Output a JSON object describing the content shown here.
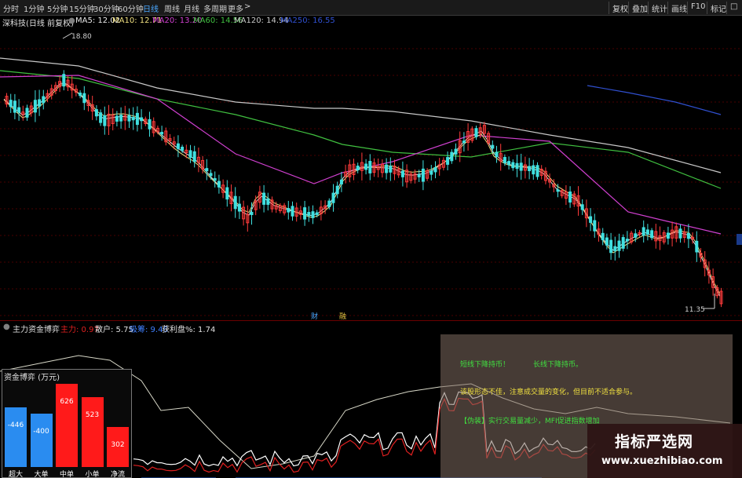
{
  "toolbar": {
    "periods": [
      "分时",
      "1分钟",
      "5分钟",
      "15分钟",
      "30分钟",
      "60分钟",
      "日线",
      "周线",
      "月线",
      "多周期",
      "更多"
    ],
    "active_period": "日线",
    "more_arrow": ">",
    "right_buttons": [
      "复权",
      "叠加",
      "统计",
      "画线",
      "F10",
      "标记"
    ],
    "expand_icon": "□"
  },
  "main_chart": {
    "stock_label": "深科技(日线 前复权)",
    "settings_icon": "●",
    "ma": [
      {
        "label": "MA5: 12.02",
        "color": "#e8e8e8"
      },
      {
        "label": "MA10: 12.71",
        "color": "#f0e080"
      },
      {
        "label": "MA20: 13.20",
        "color": "#d040d0"
      },
      {
        "label": "MA60: 14.56",
        "color": "#40c040"
      },
      {
        "label": "MA120: 14.94",
        "color": "#c8c8c8"
      },
      {
        "label": "MA250: 16.55",
        "color": "#3050d0"
      }
    ],
    "high_marker": "18.80",
    "low_marker": "11.35",
    "event_labels": [
      "财",
      "融"
    ]
  },
  "indicator": {
    "name": "主力资金博弈",
    "fields": [
      {
        "label": "主力: 0.97",
        "color": "#e02020"
      },
      {
        "label": "散户: 5.75",
        "color": "#e0e0e0"
      },
      {
        "label": "吸筹: 9.46",
        "color": "#4080ff"
      },
      {
        "label": "获利盘%: 1.74",
        "color": "#e0e0e0"
      }
    ]
  },
  "capital_panel": {
    "title": "资金博弈 (万元)",
    "bars": [
      {
        "label": "超大",
        "value": "-446",
        "amount": -446,
        "color": "#2a8cf0"
      },
      {
        "label": "大单",
        "value": "-400",
        "amount": -400,
        "color": "#2a8cf0"
      },
      {
        "label": "中单",
        "value": "626",
        "amount": 626,
        "color": "#ff1a1a"
      },
      {
        "label": "小单",
        "value": "523",
        "amount": 523,
        "color": "#ff1a1a"
      },
      {
        "label": "净流",
        "value": "302",
        "amount": 302,
        "color": "#ff1a1a"
      }
    ]
  },
  "annotations": {
    "short_term": "短线下降持币！",
    "long_term": "长线下降持币。",
    "advice": "该股形态不佳，注意成交量的变化，但目前不适合参与。",
    "signal": "【伪装】实行交易量减少，MFI促进指数增加"
  },
  "watermark": {
    "title": "指标严选网",
    "url": "www.xuezhibiao.com"
  }
}
